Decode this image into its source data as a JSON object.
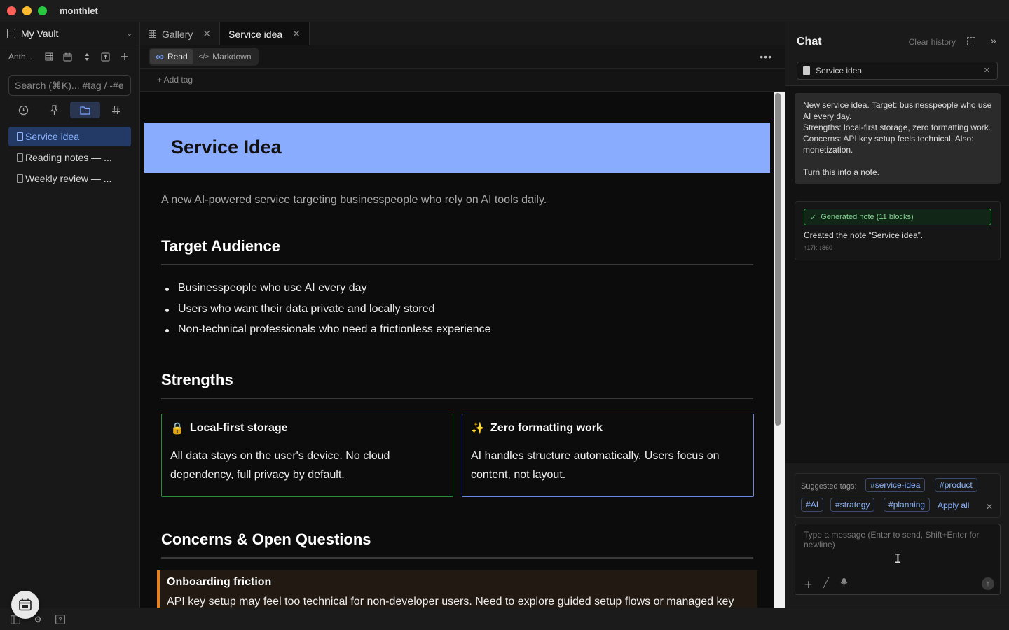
{
  "app": {
    "title": "monthlet"
  },
  "sidebar": {
    "vault_name": "My Vault",
    "toolbar_label": "Anth...",
    "search_placeholder": "Search (⌘K)... #tag / -#e",
    "files": [
      {
        "label": "Service idea",
        "active": true
      },
      {
        "label": "Reading notes — ...",
        "active": false
      },
      {
        "label": "Weekly review — ...",
        "active": false
      }
    ]
  },
  "tabs": [
    {
      "label": "Gallery"
    },
    {
      "label": "Service idea"
    }
  ],
  "modes": {
    "read": "Read",
    "markdown": "Markdown"
  },
  "tagbar": {
    "add_tag": "+ Add tag"
  },
  "document": {
    "title": "Service Idea",
    "lead": "A new AI-powered service targeting businesspeople who rely on AI tools daily.",
    "sections": {
      "audience": "Target Audience",
      "strengths": "Strengths",
      "concerns": "Concerns & Open Questions"
    },
    "audience_items": [
      "Businesspeople who use AI every day",
      "Users who want their data private and locally stored",
      "Non-technical professionals who need a frictionless experience"
    ],
    "cards": [
      {
        "emoji": "🔒",
        "title": "Local-first storage",
        "body": "All data stays on the user's device. No cloud dependency, full privacy by default.",
        "color": "#2f8a3a"
      },
      {
        "emoji": "✨",
        "title": "Zero formatting work",
        "body": "AI handles structure automatically. Users focus on content, not layout.",
        "color": "#6a86e0"
      }
    ],
    "callout": {
      "title": "Onboarding friction",
      "body": "API key setup may feel too technical for non-developer users. Need to explore guided setup flows or managed key"
    }
  },
  "chat": {
    "title": "Chat",
    "clear_history": "Clear history",
    "context_chip": "Service idea",
    "user_message_lines": [
      "New service idea. Target: businesspeople who use AI every day.",
      "Strengths: local-first storage, zero formatting work.",
      "Concerns: API key setup feels technical. Also: monetization.",
      "",
      "Turn this into a note."
    ],
    "ai_badge": "Generated note (11 blocks)",
    "ai_message": "Created the note “Service idea”.",
    "ai_tokens": "↑17k ↓860",
    "suggested_tags_label": "Suggested tags:",
    "suggested_tags": [
      "service-idea",
      "product",
      "AI",
      "strategy",
      "planning"
    ],
    "apply_all": "Apply all",
    "input_placeholder": "Type a message (Enter to send, Shift+Enter for newline)"
  },
  "colors": {
    "accent": "#8ab4ff",
    "hero": "#8aacff",
    "callout_border": "#e8811c"
  }
}
